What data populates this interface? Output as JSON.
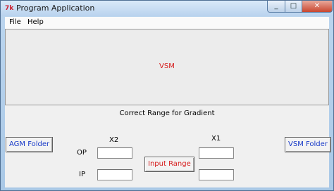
{
  "window": {
    "title": "Program Application",
    "icon": "tk-feather-icon"
  },
  "menu": [
    {
      "label": "File"
    },
    {
      "label": "Help"
    }
  ],
  "panel": {
    "label": "VSM"
  },
  "caption": "Correct Range for Gradient",
  "buttons": {
    "agm_folder": "AGM Folder",
    "vsm_folder": "VSM Folder",
    "input_range": "Input Range"
  },
  "columns": {
    "x2": "X2",
    "x1": "X1"
  },
  "rows": {
    "op": "OP",
    "ip": "IP"
  },
  "inputs": {
    "op_x2": "",
    "op_x1": "",
    "ip_x2": "",
    "ip_x1": ""
  },
  "colors": {
    "accent_blue": "#1739c8",
    "accent_red": "#d61a1a"
  }
}
